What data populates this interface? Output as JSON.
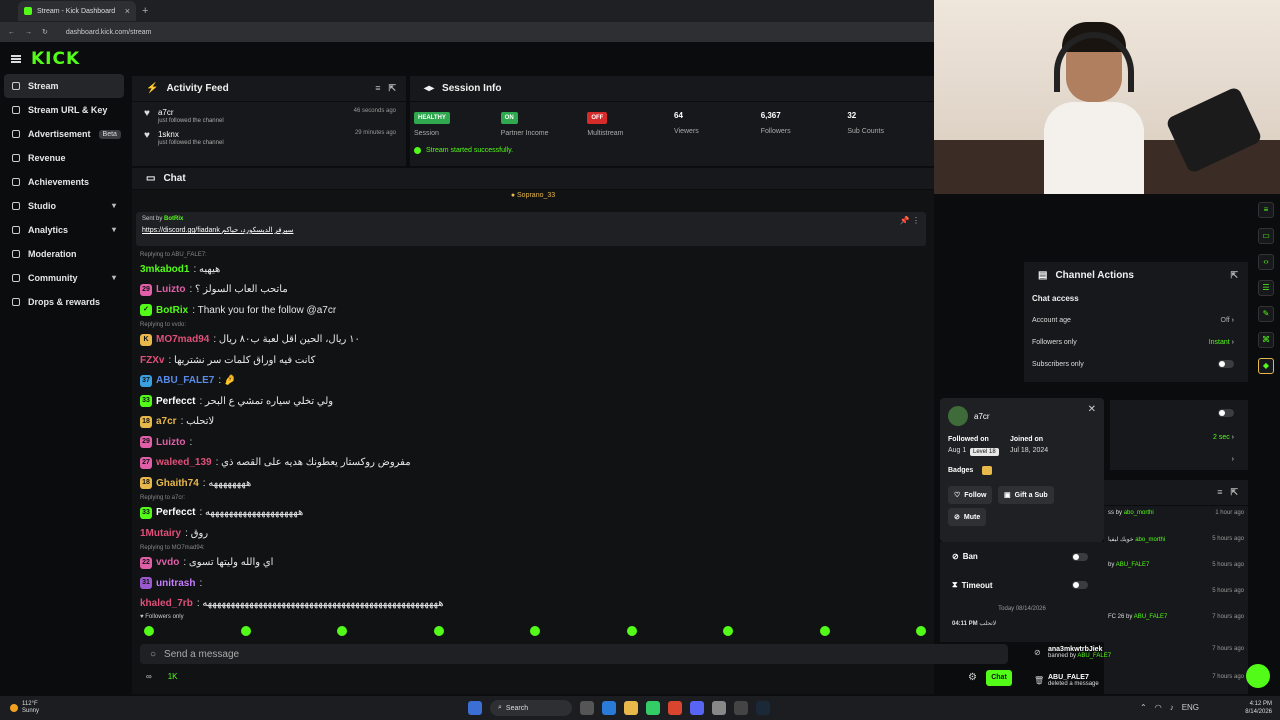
{
  "browser": {
    "tab_title": "Stream - Kick Dashboard",
    "url": "dashboard.kick.com/stream",
    "new_tab": "+",
    "close": "×"
  },
  "brand": {
    "logo": "KICK",
    "accent": "#53fc18"
  },
  "sidebar": {
    "items": [
      {
        "label": "Stream",
        "active": true
      },
      {
        "label": "Stream URL & Key"
      },
      {
        "label": "Advertisement",
        "badge": "Beta"
      },
      {
        "label": "Revenue"
      },
      {
        "label": "Achievements"
      },
      {
        "label": "Studio",
        "chevron": "▾"
      },
      {
        "label": "Analytics",
        "chevron": "▾"
      },
      {
        "label": "Moderation"
      },
      {
        "label": "Community",
        "chevron": "▾"
      },
      {
        "label": "Drops & rewards"
      }
    ]
  },
  "activity": {
    "title": "Activity Feed",
    "items": [
      {
        "name": "a7cr",
        "action": "just followed the channel",
        "time": "46 seconds ago"
      },
      {
        "name": "1sknx",
        "action": "just followed the channel",
        "time": "29 minutes ago"
      }
    ]
  },
  "session": {
    "title": "Session Info",
    "stats": [
      {
        "pill": "HEALTHY",
        "pill_color": "#2fa84f",
        "label": "Session"
      },
      {
        "pill": "ON",
        "pill_color": "#2fa84f",
        "label": "Partner Income"
      },
      {
        "pill": "OFF",
        "pill_color": "#d62b2b",
        "label": "Multistream"
      },
      {
        "value": "64",
        "label": "Viewers"
      },
      {
        "value": "6,367",
        "label": "Followers"
      },
      {
        "value": "32",
        "label": "Sub Counts"
      }
    ],
    "status": "Stream started successfully."
  },
  "chat": {
    "title": "Chat",
    "pinned_banner": "Soprano_33",
    "pinned": {
      "sent_by": "Sent by",
      "author": "BotRix",
      "link": "https://discord.gg/fiadank سيرفر الديسكورد، حياكم"
    },
    "messages": [
      {
        "reply": "Replying to ABU_FALE7:"
      },
      {
        "badge": "",
        "user": "3mkabod1",
        "color": "#53fc18",
        "text": ": هيهيه"
      },
      {
        "badge": "29",
        "badge_color": "#e05fa8",
        "user": "Luizto",
        "color": "#e05fa8",
        "text": ": ماتحب العاب السولز ؟"
      },
      {
        "badge": "✓",
        "badge_color": "#53fc18",
        "user": "BotRix",
        "color": "#53fc18",
        "text": ": Thank you for the follow @a7cr"
      },
      {
        "reply": "Replying to vvdo:"
      },
      {
        "badge": "K",
        "badge_color": "#e8b84b",
        "user": "MO7mad94",
        "color": "#e0507a",
        "text": ": ١٠ ريال، الحين اقل لعبة ب٨٠ ريال"
      },
      {
        "badge": "",
        "user": "FZXv",
        "color": "#e0507a",
        "text": ": كانت فيه اوراق كلمات سر نشتريها"
      },
      {
        "badge": "37",
        "badge_color": "#3aa0e0",
        "user": "ABU_FALE7",
        "color": "#5b8be8",
        "text": ": 🤌"
      },
      {
        "badge": "33",
        "badge_color": "#53fc18",
        "user": "Perfecct",
        "color": "#ffffff",
        "text": ": ولي تخلي سياره تمشي ع البحر"
      },
      {
        "badge": "18",
        "badge_color": "#e8b84b",
        "user": "a7cr",
        "color": "#e8b84b",
        "text": ": لاتحلب"
      },
      {
        "badge": "29",
        "badge_color": "#e05fa8",
        "user": "Luizto",
        "color": "#e05fa8",
        "text": ":"
      },
      {
        "badge": "27",
        "badge_color": "#e05fa8",
        "user": "waleed_139",
        "color": "#e0507a",
        "text": ": مفروض روكستار يعطونك هديه على القصه ذي"
      },
      {
        "badge": "18",
        "badge_color": "#e8b84b",
        "user": "Ghaith74",
        "color": "#e8b84b",
        "text": ": ههههههههه"
      },
      {
        "reply": "Replying to a7cr:"
      },
      {
        "badge": "33",
        "badge_color": "#53fc18",
        "user": "Perfecct",
        "color": "#ffffff",
        "text": ": ههههههههههههههههههههه"
      },
      {
        "badge": "",
        "user": "1Mutairy",
        "color": "#e0507a",
        "text": ": روق"
      },
      {
        "reply": "Replying to MO7mad94:"
      },
      {
        "badge": "22",
        "badge_color": "#e05fa8",
        "user": "vvdo",
        "color": "#e05fa8",
        "text": ": اي والله وليتها تسوى"
      },
      {
        "badge": "31",
        "badge_color": "#9b59d0",
        "user": "unitrash",
        "color": "#c77dff",
        "text": ":"
      },
      {
        "badge": "",
        "user": "khaled_7rb",
        "color": "#e0507a",
        "text": ": هههههههههههههههههههههههههههههههههههههههههههههههههههه"
      }
    ],
    "followers_only": "Followers only",
    "placeholder": "Send a message",
    "footer_left": "∞",
    "footer_count": "1K",
    "send_button": "Chat"
  },
  "channel_actions": {
    "title": "Channel Actions",
    "section": "Chat access",
    "rows": [
      {
        "label": "Account age",
        "value": "Off"
      },
      {
        "label": "Followers only",
        "value": "Instant"
      },
      {
        "label": "Subscribers only"
      }
    ],
    "slow_value": "2 sec"
  },
  "mod_log": [
    {
      "text": "ss by",
      "user": "abo_morthi",
      "time": "1 hour ago"
    },
    {
      "text": "خويك ليفيا",
      "user": "abo_morthi",
      "time": "5 hours ago"
    },
    {
      "text": "by",
      "user": "ABU_FALE7",
      "time": "5 hours ago"
    },
    {
      "text": "",
      "user": "",
      "time": "5 hours ago"
    },
    {
      "text": "FC 26 by",
      "user": "ABU_FALE7",
      "time": "7 hours ago"
    }
  ],
  "mod_log_bottom": [
    {
      "name": "ana3mkwtrbJiek",
      "action": "banned by",
      "user": "ABU_FALE7",
      "time": "7 hours ago"
    },
    {
      "name": "ABU_FALE7",
      "action": "deleted a message",
      "user": "",
      "time": "7 hours ago"
    }
  ],
  "user_card": {
    "username": "a7cr",
    "followed_label": "Followed on",
    "followed_value": "Aug 1",
    "tooltip": "Level 18",
    "joined_label": "Joined on",
    "joined_value": "Jul 18, 2024",
    "badges_label": "Badges",
    "follow": "Follow",
    "gift": "Gift a Sub",
    "mute": "Mute",
    "ban": "Ban",
    "timeout": "Timeout",
    "date": "Today 08/14/2026",
    "last_msg_time": "04:11 PM",
    "last_msg": "لاتحلب"
  },
  "taskbar": {
    "weather_temp": "112°F",
    "weather_desc": "Sunny",
    "search": "Search",
    "time": "4:12 PM",
    "date": "8/14/2026",
    "lang": "ENG"
  }
}
